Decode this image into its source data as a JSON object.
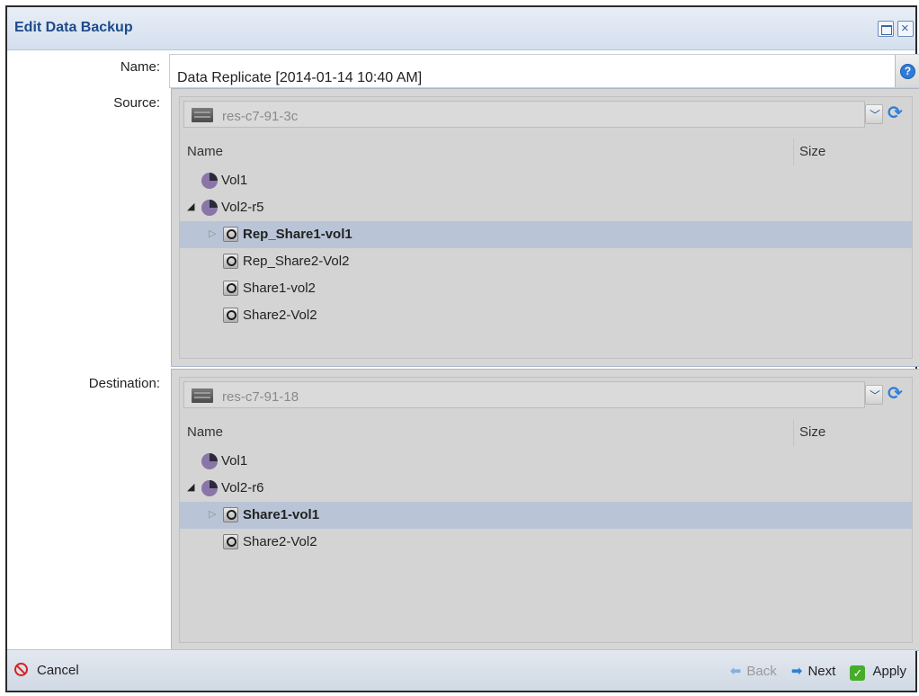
{
  "window": {
    "title": "Edit Data Backup"
  },
  "form": {
    "name_label": "Name:",
    "name_value": "Data Replicate [2014-01-14 10:40 AM]",
    "source_label": "Source:",
    "destination_label": "Destination:"
  },
  "source": {
    "server": "res-c7-91-3c",
    "columns": {
      "name": "Name",
      "size": "Size"
    },
    "rows": [
      {
        "label": "Vol1",
        "type": "volume",
        "level": 0,
        "expander": "none",
        "selected": false
      },
      {
        "label": "Vol2-r5",
        "type": "volume",
        "level": 0,
        "expander": "open",
        "selected": false
      },
      {
        "label": "Rep_Share1-vol1",
        "type": "share",
        "level": 1,
        "expander": "closed",
        "selected": true
      },
      {
        "label": "Rep_Share2-Vol2",
        "type": "share",
        "level": 1,
        "expander": "none",
        "selected": false
      },
      {
        "label": "Share1-vol2",
        "type": "share",
        "level": 1,
        "expander": "none",
        "selected": false
      },
      {
        "label": "Share2-Vol2",
        "type": "share",
        "level": 1,
        "expander": "none",
        "selected": false
      }
    ]
  },
  "destination": {
    "server": "res-c7-91-18",
    "columns": {
      "name": "Name",
      "size": "Size"
    },
    "rows": [
      {
        "label": "Vol1",
        "type": "volume",
        "level": 0,
        "expander": "none",
        "selected": false
      },
      {
        "label": "Vol2-r6",
        "type": "volume",
        "level": 0,
        "expander": "open",
        "selected": false
      },
      {
        "label": "Share1-vol1",
        "type": "share",
        "level": 1,
        "expander": "closed",
        "selected": true
      },
      {
        "label": "Share2-Vol2",
        "type": "share",
        "level": 1,
        "expander": "none",
        "selected": false
      }
    ]
  },
  "footer": {
    "cancel_label": "Cancel",
    "back_label": "Back",
    "next_label": "Next",
    "apply_label": "Apply"
  },
  "icons": {
    "help": "help-icon",
    "maximize": "maximize-icon",
    "close": "close-icon",
    "server": "server-icon",
    "volume": "volume-icon",
    "share": "share-icon",
    "refresh": "refresh-icon",
    "cancel": "cancel-icon",
    "back_arrow": "back-arrow-icon",
    "next_arrow": "next-arrow-icon",
    "apply": "checkmark-icon"
  },
  "colors": {
    "title_text": "#1d4a8a",
    "selected_row": "#b9c5d6",
    "cancel_red": "#d62020",
    "apply_green": "#46ad2a",
    "arrow_blue": "#2f7fd8"
  }
}
